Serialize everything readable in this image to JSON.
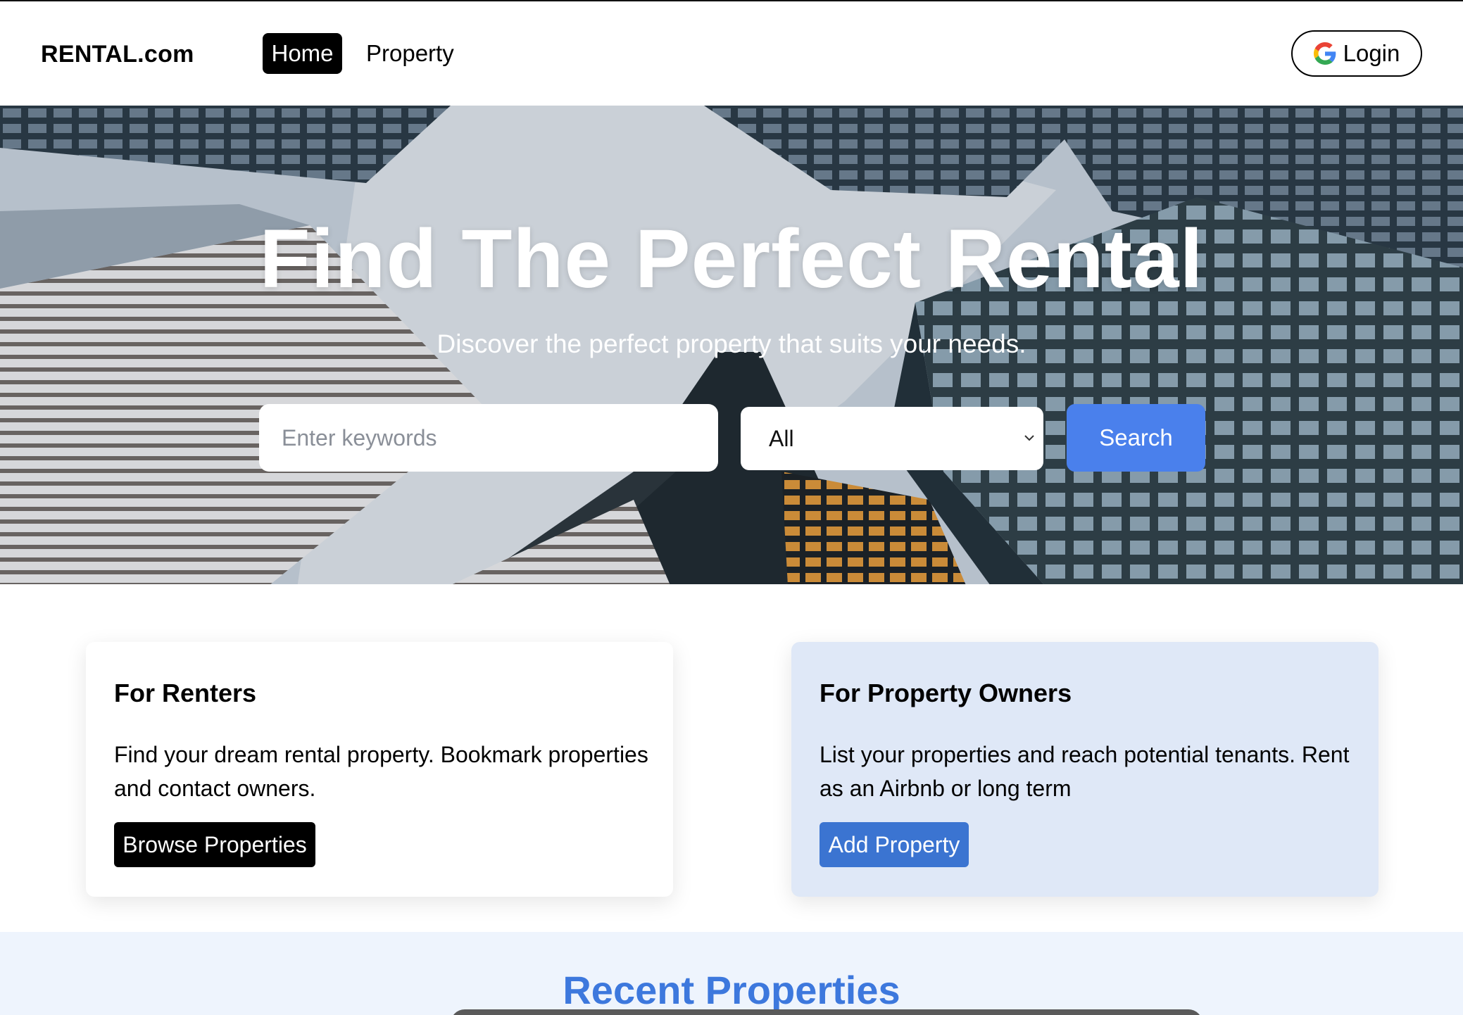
{
  "nav": {
    "brand": "RENTAL.com",
    "links": [
      {
        "label": "Home",
        "active": true
      },
      {
        "label": "Property",
        "active": false
      }
    ],
    "login_label": "Login",
    "login_icon": "google-icon"
  },
  "hero": {
    "title": "Find The Perfect Rental",
    "subtitle": "Discover the perfect property that suits your needs.",
    "search_placeholder": "Enter keywords",
    "search_value": "",
    "type_select_value": "All",
    "search_button": "Search"
  },
  "cards": {
    "renters": {
      "title": "For Renters",
      "text": "Find your dream rental property. Bookmark properties and contact owners.",
      "button": "Browse Properties"
    },
    "owners": {
      "title": "For Property Owners",
      "text": "List your properties and reach potential tenants. Rent as an Airbnb or long term",
      "button": "Add Property"
    }
  },
  "recent": {
    "title": "Recent Properties"
  },
  "colors": {
    "accent_blue": "#4a80ec",
    "owners_card_bg": "#dfe8f7",
    "recent_title": "#3d78dd",
    "primary_dark": "#000000"
  }
}
